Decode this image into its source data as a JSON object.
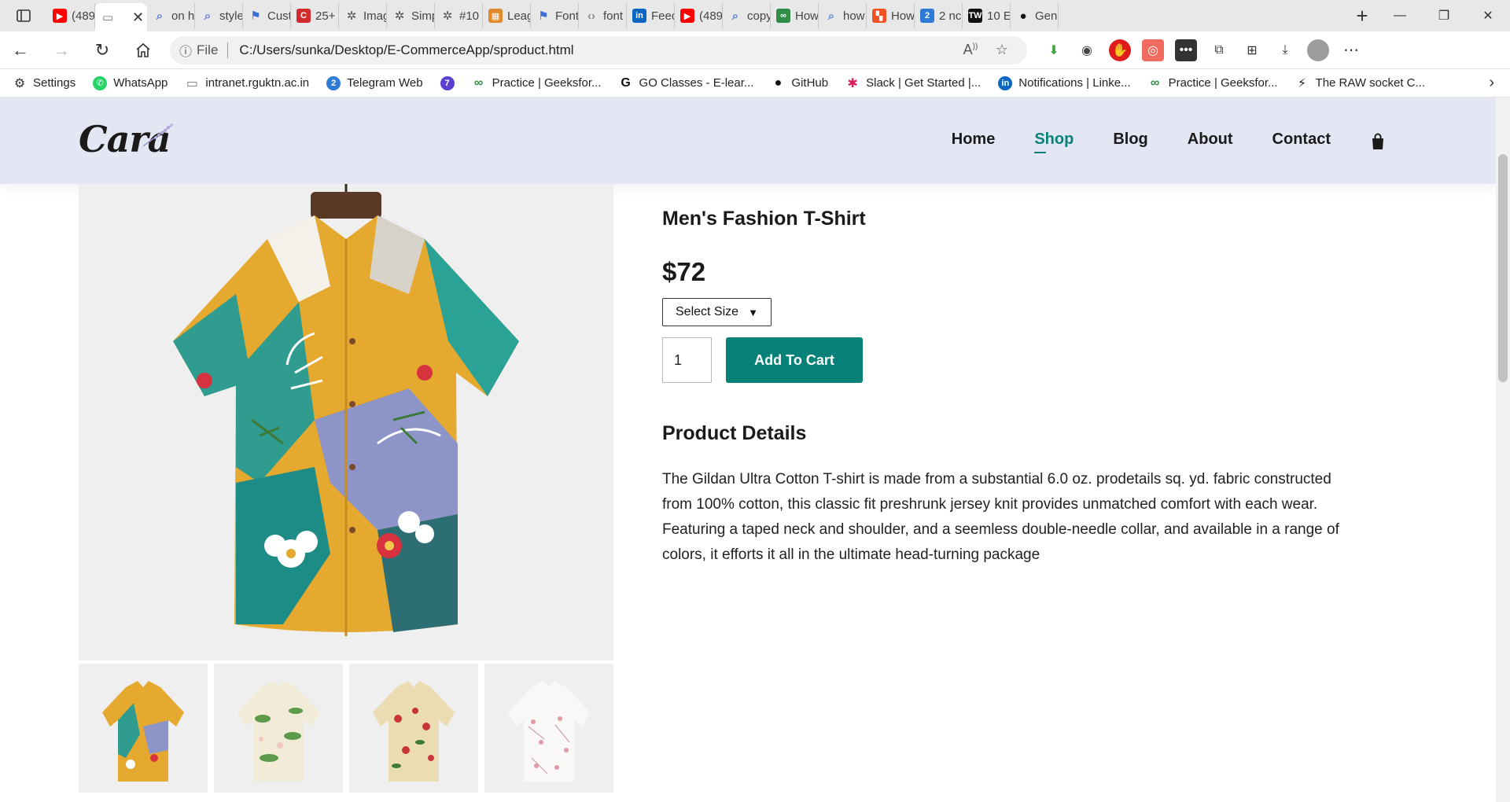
{
  "browser": {
    "tabs": [
      {
        "label": "(489",
        "icon": "youtube-icon",
        "color": "#ff0000"
      },
      {
        "label": "",
        "icon": "page-icon",
        "active": true
      },
      {
        "label": "on h",
        "icon": "search-icon"
      },
      {
        "label": "style",
        "icon": "search-icon"
      },
      {
        "label": "Cust",
        "icon": "flag-icon"
      },
      {
        "label": "25+",
        "icon": "cc-icon"
      },
      {
        "label": "Imag",
        "icon": "openai-icon"
      },
      {
        "label": "Simp",
        "icon": "openai-icon"
      },
      {
        "label": "#10",
        "icon": "openai-icon"
      },
      {
        "label": "Leag",
        "icon": "grid-icon"
      },
      {
        "label": "Font",
        "icon": "flag-icon"
      },
      {
        "label": "font",
        "icon": "code-icon"
      },
      {
        "label": "Feed",
        "icon": "linkedin-icon"
      },
      {
        "label": "(489",
        "icon": "youtube-icon"
      },
      {
        "label": "copy",
        "icon": "search-icon"
      },
      {
        "label": "How",
        "icon": "gfg-icon"
      },
      {
        "label": "how",
        "icon": "search-icon"
      },
      {
        "label": "How",
        "icon": "microsoft-icon"
      },
      {
        "label": "2 nc",
        "icon": "badge-2-icon"
      },
      {
        "label": "10 E",
        "icon": "tw-icon"
      },
      {
        "label": "Gen",
        "icon": "github-icon"
      }
    ],
    "file_label": "File",
    "url": "C:/Users/sunka/Desktop/E-CommerceApp/sproduct.html",
    "bookmarks": [
      {
        "label": "Settings",
        "icon": "gear-icon"
      },
      {
        "label": "WhatsApp",
        "icon": "whatsapp-icon"
      },
      {
        "label": "intranet.rguktn.ac.in",
        "icon": "page-icon"
      },
      {
        "label": "Telegram Web",
        "icon": "badge-2-icon"
      },
      {
        "label": "",
        "icon": "badge-709-icon"
      },
      {
        "label": "Practice | Geeksfor...",
        "icon": "gfg-icon"
      },
      {
        "label": "GO Classes - E-lear...",
        "icon": "g-icon"
      },
      {
        "label": "GitHub",
        "icon": "github-icon"
      },
      {
        "label": "Slack | Get Started |...",
        "icon": "slack-icon"
      },
      {
        "label": "Notifications | Linke...",
        "icon": "linkedin-icon"
      },
      {
        "label": "Practice | Geeksfor...",
        "icon": "gfg-icon"
      },
      {
        "label": "The RAW socket C...",
        "icon": "raw-icon"
      }
    ]
  },
  "site": {
    "logo": "Cara",
    "nav": [
      "Home",
      "Shop",
      "Blog",
      "About",
      "Contact"
    ],
    "active_nav": "Shop"
  },
  "product": {
    "title": "Men's Fashion T-Shirt",
    "price": "$72",
    "size_select": "Select Size",
    "quantity": "1",
    "add_to_cart": "Add To Cart",
    "details_heading": "Product Details",
    "description": "The Gildan Ultra Cotton T-shirt is made from a substantial 6.0 oz. prodetails sq. yd. fabric constructed from 100% cotton, this classic fit preshrunk jersey knit provides unmatched comfort with each wear. Featuring a taped neck and shoulder, and a seemless double-needle collar, and available in a range of colors, it efforts it all in the ultimate head-turning package",
    "accent_color": "#088178",
    "header_bg": "#e3e6f3"
  }
}
